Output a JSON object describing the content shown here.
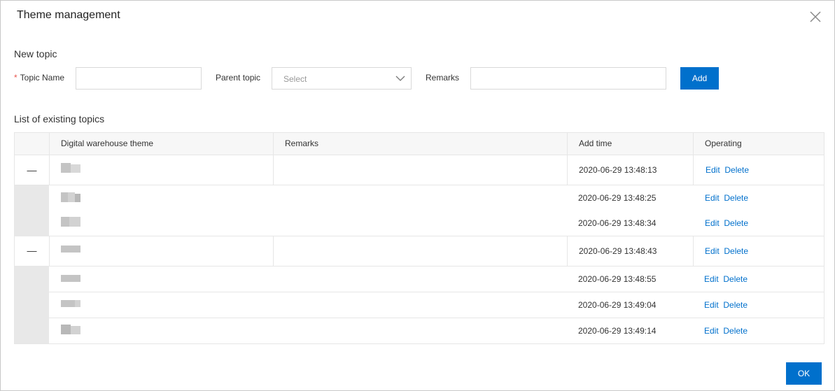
{
  "dialog": {
    "title": "Theme management"
  },
  "new_topic": {
    "heading": "New topic",
    "topic_name_label": "Topic Name",
    "required_mark": "*",
    "topic_name_value": "",
    "parent_topic_label": "Parent topic",
    "parent_topic_placeholder": "Select",
    "remarks_label": "Remarks",
    "remarks_value": "",
    "add_label": "Add"
  },
  "list": {
    "heading": "List of existing topics",
    "columns": [
      "Digital warehouse theme",
      "Remarks",
      "Add time",
      "Operating"
    ],
    "collapse_glyph": "—",
    "edit_label": "Edit",
    "delete_label": "Delete",
    "rows": [
      {
        "level": "parent",
        "time": "2020-06-29 13:48:13"
      },
      {
        "level": "child",
        "time": "2020-06-29 13:48:25"
      },
      {
        "level": "child",
        "time": "2020-06-29 13:48:34"
      },
      {
        "level": "parent",
        "time": "2020-06-29 13:48:43"
      },
      {
        "level": "child",
        "time": "2020-06-29 13:48:55"
      },
      {
        "level": "child",
        "time": "2020-06-29 13:49:04"
      },
      {
        "level": "child",
        "time": "2020-06-29 13:49:14"
      }
    ]
  },
  "footer": {
    "ok_label": "OK"
  },
  "colors": {
    "accent": "#0070cc",
    "required": "#e8554e",
    "child_indent_block": "#e8e8e8"
  }
}
